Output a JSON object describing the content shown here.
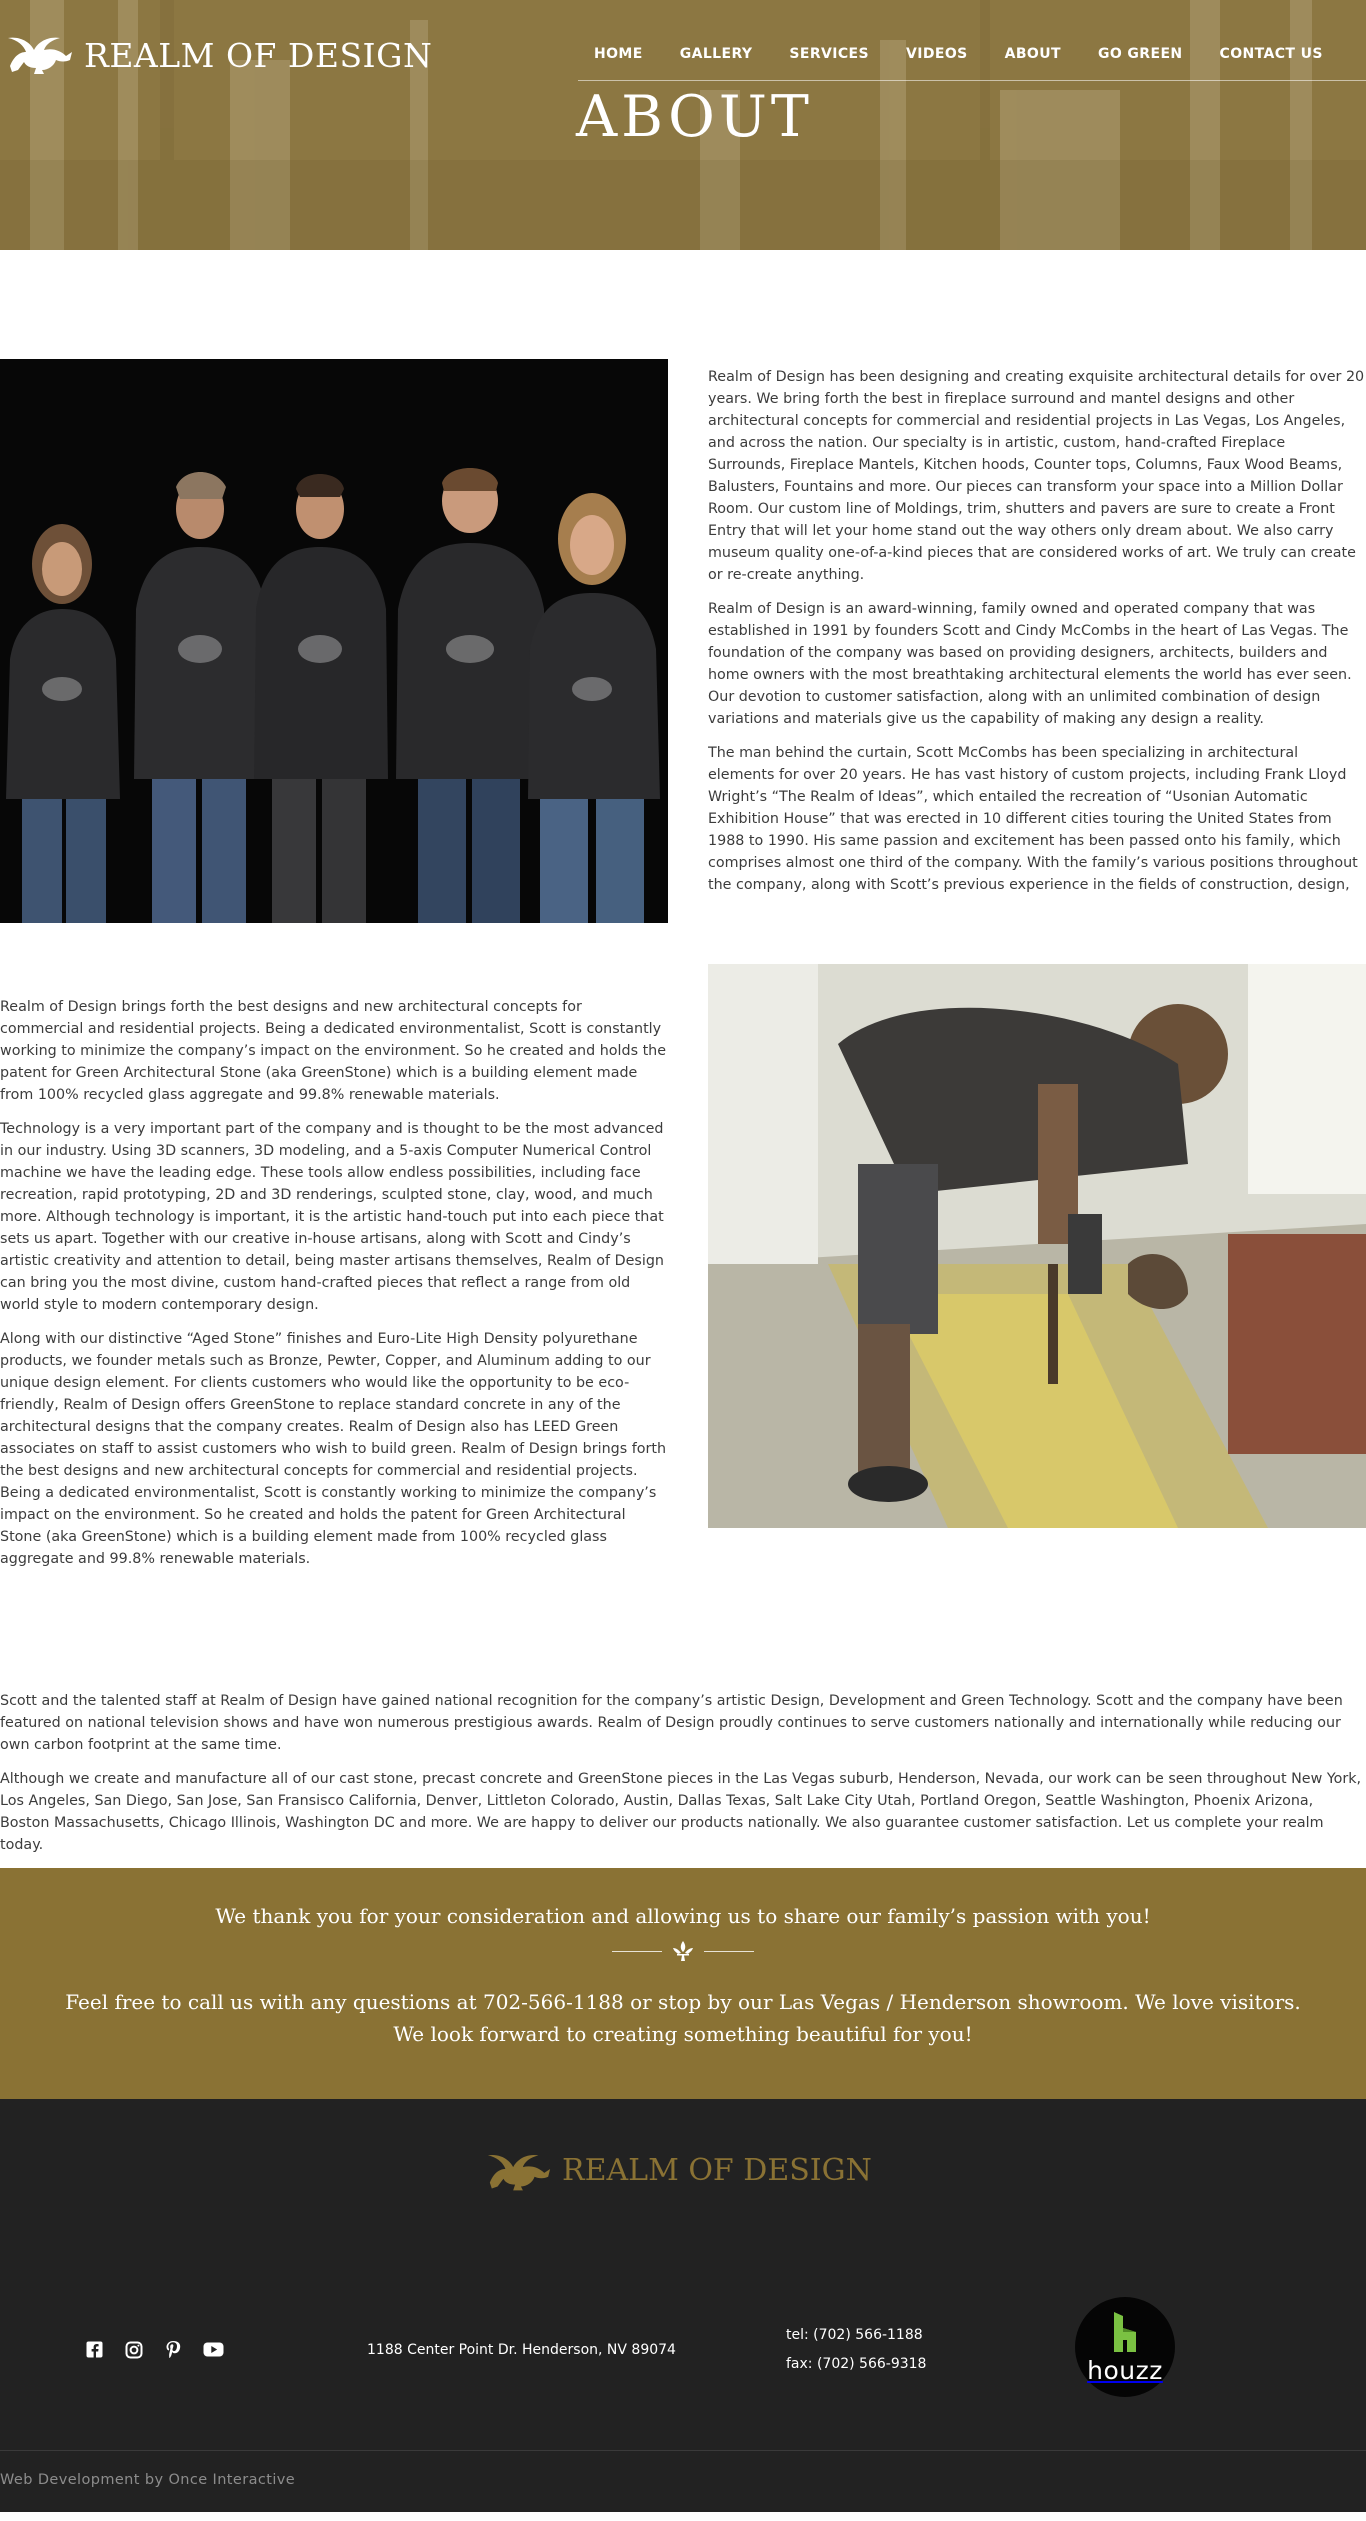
{
  "header": {
    "logo_text": "REALM OF DESIGN",
    "nav": [
      "HOME",
      "GALLERY",
      "SERVICES",
      "VIDEOS",
      "ABOUT",
      "GO GREEN",
      "CONTACT US"
    ],
    "page_title": "ABOUT"
  },
  "section1": {
    "paragraphs": [
      "Realm of Design has been designing and creating exquisite architectural details for over 20 years. We bring forth the best in fireplace surround and mantel designs and other architectural concepts for commercial and residential projects in Las Vegas, Los Angeles, and across the nation. Our specialty is in artistic, custom, hand-crafted Fireplace Surrounds, Fireplace Mantels, Kitchen hoods, Counter tops, Columns, Faux Wood Beams, Balusters, Fountains and more. Our pieces can transform your space into a Million Dollar Room. Our custom line of Moldings, trim, shutters and pavers are sure to create a Front Entry that will let your home stand out the way others only dream about. We also carry museum quality one-of-a-kind pieces that are considered works of art. We truly can create or re-create anything.",
      "Realm of Design is an award-winning, family owned and operated company that was established in 1991 by founders Scott and Cindy McCombs in the heart of Las Vegas. The foundation of the company was based on providing designers, architects, builders and home owners with the most breathtaking architectural elements the world has ever seen. Our devotion to customer satisfaction, along with an unlimited combination of design variations and materials give us the capability of making any design a reality.",
      "The man behind the curtain, Scott McCombs has been specializing in architectural elements for over 20 years. He has vast history of custom projects, including Frank Lloyd Wright’s “The Realm of Ideas”, which entailed the recreation of “Usonian Automatic Exhibition House” that was erected in 10 different cities touring the United States from 1988 to 1990. His same passion and excitement has been passed onto his family, which comprises almost one third of the company. With the family’s various positions throughout the company, along with Scott’s previous experience in the fields of construction, design, building, and engineering, Realm of Design brings forth the best designs and new architectural concepts for commercial and residential projects. Being a dedicated environmentalist, Scott is constantly working to minimize the company’s impact on the environment. So he created and holds the patent for Green Architectural Stone (aka GreenStone) which is a building element made from 100% recycled glass aggregate and 99.8% renewable materials."
    ]
  },
  "section2": {
    "paragraphs": [
      "Realm of Design brings forth the best designs and new architectural concepts for commercial and residential projects. Being a dedicated environmentalist, Scott is constantly working to minimize the company’s impact on the environment. So he created and holds the patent for Green Architectural Stone (aka GreenStone) which is a building element made from 100% recycled glass aggregate and 99.8% renewable materials.",
      "Technology is a very important part of the company and is thought to be the most advanced in our industry. Using 3D scanners, 3D modeling, and a 5-axis Computer Numerical Control machine we have the leading edge. These tools allow endless possibilities, including face recreation, rapid prototyping, 2D and 3D renderings, sculpted stone, clay, wood, and much more. Although technology is important, it is the artistic hand-touch put into each piece that sets us apart. Together with our creative in-house artisans, along with Scott and Cindy’s artistic creativity and attention to detail, being master artisans themselves, Realm of Design can bring you the most divine, custom hand-crafted pieces that reflect a range from old world style to modern contemporary design.",
      "Along with our distinctive “Aged Stone” finishes and Euro-Lite High Density polyurethane products, we founder metals such as Bronze, Pewter, Copper, and Aluminum adding to our unique design element. For clients customers who would like the opportunity to be eco-friendly, Realm of Design offers GreenStone to replace standard concrete in any of the architectural designs that the company creates. Realm of Design also has LEED Green associates on staff to assist customers who wish to build green. Realm of Design brings forth the best designs and new architectural concepts for commercial and residential projects. Being a dedicated environmentalist, Scott is constantly working to minimize the company’s impact on the environment. So he created and holds the patent for Green Architectural Stone (aka GreenStone) which is a building element made from 100% recycled glass aggregate and 99.8% renewable materials."
    ]
  },
  "section3": {
    "paragraphs": [
      "Scott and the talented staff at Realm of Design have gained national recognition for the company’s artistic Design, Development and Green Technology. Scott and the company have been featured on national television shows and have won numerous prestigious awards. Realm of Design proudly continues to serve customers nationally and internationally while reducing our own carbon footprint at the same time.",
      "Although we create and manufacture all of our cast stone, precast concrete and GreenStone pieces in the Las Vegas suburb, Henderson, Nevada, our work can be seen throughout New York, Los Angeles, San Diego, San Jose, San Fransisco California, Denver, Littleton Colorado, Austin, Dallas Texas, Salt Lake City Utah, Portland Oregon, Seattle Washington, Phoenix Arizona, Boston Massachusetts, Chicago Illinois, Washington DC and more. We are happy to deliver our products nationally. We also guarantee customer satisfaction. Let us complete your realm today."
    ]
  },
  "cta": {
    "thanks": "We thank you for your consideration and allowing us to share our family’s passion with you!",
    "call": "Feel free to call us with any questions at 702-566-1188 or stop by our Las Vegas / Henderson showroom. We love visitors. We look forward to creating something beautiful for you!"
  },
  "footer": {
    "logo_text": "REALM OF DESIGN",
    "social_icons": [
      "facebook-icon",
      "instagram-icon",
      "pinterest-icon",
      "youtube-icon"
    ],
    "address": "1188 Center Point Dr. Henderson, NV 89074",
    "tel": "tel: (702) 566-1188",
    "fax": "fax: (702) 566-9318",
    "houzz": "houzz",
    "credit": "Web Development by Once Interactive"
  },
  "colors": {
    "gold": "#8a7234",
    "footer_bg": "#222222",
    "houzz_green": "#7ac142"
  }
}
